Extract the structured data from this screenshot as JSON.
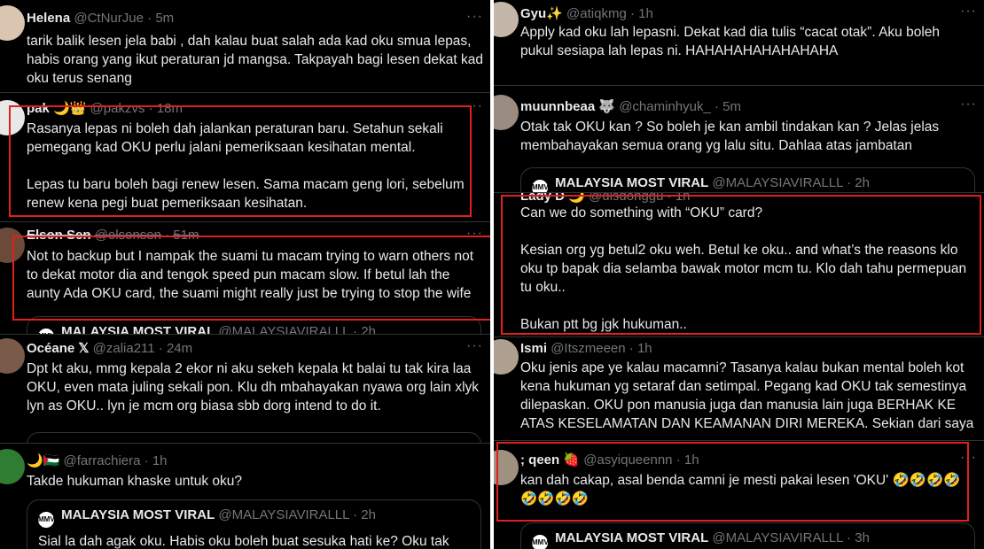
{
  "left": {
    "tweets": [
      {
        "name": "Helena",
        "handle": "@CtNurJue",
        "time": "5m",
        "text": "tarik balik lesen jela babi , dah kalau buat salah ada kad oku smua lepas,\nhabis orang yang ikut peraturan jd mangsa. Takpayah bagi lesen dekat kad\noku terus senang"
      },
      {
        "name": "pak 🌙👑",
        "handle": "@pakzvs",
        "time": "18m",
        "text": "Rasanya lepas ni boleh dah jalankan peraturan baru. Setahun sekali\npemegang kad OKU perlu jalani pemeriksaan kesihatan mental.\n\nLepas tu baru boleh bagi renew lesen. Sama macam geng lori, sebelum\nrenew kena pegi buat pemeriksaan kesihatan."
      },
      {
        "name": "Elson Sen",
        "handle": "@elsonsen",
        "time": "51m",
        "text": "Not to backup but I nampak the suami tu macam trying to warn others not\nto dekat motor dia and tengok speed pun macam slow. If betul lah the\naunty Ada OKU card, the suami might really just be trying to stop the wife",
        "quote_name": "MALAYSIA MOST VIRAL",
        "quote_handle": "@MALAYSIAVIRALLL",
        "quote_time": "2h"
      },
      {
        "name": "Océane 𝕏",
        "handle": "@zalia211",
        "time": "24m",
        "text": "Dpt kt aku, mmg kepala 2 ekor ni aku sekeh kepala kt balai tu tak kira laa\nOKU, even mata juling sekali pon. Klu dh mbahayakan nyawa org lain xlyk\nlyn as OKU.. lyn je mcm org biasa sbb dorg intend to do it."
      },
      {
        "name": "🌙🇵🇸",
        "handle": "@farrachiera",
        "time": "1h",
        "text": "Takde hukuman khaske untuk oku?",
        "quote_name": "MALAYSIA MOST VIRAL",
        "quote_handle": "@MALAYSIAVIRALLL",
        "quote_time": "2h",
        "quote_text": "Sial la dah agak oku. Habis oku boleh buat sesuka hati ke? Oku tak oku"
      }
    ]
  },
  "right": {
    "tweets": [
      {
        "name": "Gyu✨",
        "handle": "@atiqkmg",
        "time": "1h",
        "text": "Apply kad oku lah lepasni. Dekat kad dia tulis “cacat otak”. Aku boleh\npukul sesiapa lah lepas ni. HAHAHAHAHAHAHAHA"
      },
      {
        "name": "muunnbeaa 🐺",
        "handle": "@chaminhyuk_",
        "time": "5m",
        "text": "Otak tak OKU kan ? So boleh je kan ambil tindakan kan ? Jelas jelas\nmembahayakan semua orang yg lalu situ. Dahlaa atas jambatan",
        "quote_name": "MALAYSIA MOST VIRAL",
        "quote_handle": "@MALAYSIAVIRALLL",
        "quote_time": "2h"
      },
      {
        "name": "Lady D 🌙",
        "handle": "@disdonggu",
        "time": "1h",
        "text": "Can we do something with “OKU” card?\n\nKesian org yg betul2 oku weh. Betul ke oku.. and what’s the reasons klo\noku tp bapak dia selamba bawak motor mcm tu. Klo dah tahu permepuan\ntu oku..\n\nBukan ptt bg jgk hukuman.."
      },
      {
        "name": "Ismi",
        "handle": "@Itszmeeen",
        "time": "1h",
        "text": "Oku jenis ape ye kalau macamni? Tasanya kalau bukan mental boleh kot\nkena hukuman yg setaraf dan setimpal. Pegang kad OKU tak semestinya\ndilepaskan. OKU pon manusia juga dan manusia lain juga BERHAK KE\nATAS KESELAMATAN DAN KEAMANAN DIRI MEREKA. Sekian dari saya"
      },
      {
        "name": "; qeen 🍓",
        "handle": "@asyiqueennn",
        "time": "1h",
        "text": "kan dah cakap, asal benda camni je mesti pakai lesen 'OKU' 🤣🤣🤣🤣\n🤣🤣🤣🤣",
        "quote_name": "MALAYSIA MOST VIRAL",
        "quote_handle": "@MALAYSIAVIRALLL",
        "quote_time": "3h"
      }
    ]
  },
  "quote_icon_text": "MMV",
  "more_glyph": "···",
  "dot": "·",
  "colors": {
    "highlight_box": "#e0201c",
    "background": "#000000",
    "text": "#e7e9ea",
    "muted": "#71767b",
    "border": "#2f3336"
  }
}
